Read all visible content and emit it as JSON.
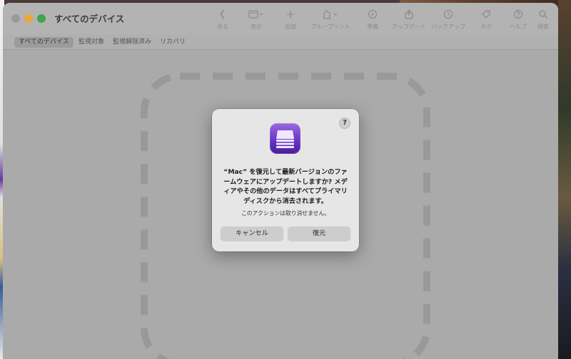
{
  "window": {
    "title": "すべてのデバイス"
  },
  "toolbar": {
    "items": [
      {
        "label": "戻る",
        "icon": "chevron-left-icon"
      },
      {
        "label": "表示",
        "icon": "view-icon"
      },
      {
        "label": "追加",
        "icon": "plus-icon"
      },
      {
        "label": "ブループリント",
        "icon": "blueprint-icon"
      },
      {
        "label": "準備",
        "icon": "prepare-icon"
      },
      {
        "label": "アップデート",
        "icon": "update-icon"
      },
      {
        "label": "バックアップ",
        "icon": "backup-icon"
      },
      {
        "label": "タグ",
        "icon": "tag-icon"
      },
      {
        "label": "ヘルプ",
        "icon": "help-icon"
      },
      {
        "label": "検索",
        "icon": "search-icon"
      }
    ]
  },
  "tabs": [
    {
      "label": "すべてのデバイス",
      "active": true
    },
    {
      "label": "監視対象",
      "active": false
    },
    {
      "label": "監視解除済み",
      "active": false
    },
    {
      "label": "リカバリ",
      "active": false
    }
  ],
  "dialog": {
    "help_label": "?",
    "message": "“Mac” を復元して最新バージョンのファームウェアにアップデートしますか? メディアやその他のデータはすべてプライマリディスクから消去されます。",
    "subtext": "このアクションは取り消せません。",
    "cancel_label": "キャンセル",
    "confirm_label": "復元"
  },
  "colors": {
    "accent_purple": "#6a36c8",
    "traffic_min": "#e8a93a",
    "traffic_max": "#3aa84a"
  }
}
